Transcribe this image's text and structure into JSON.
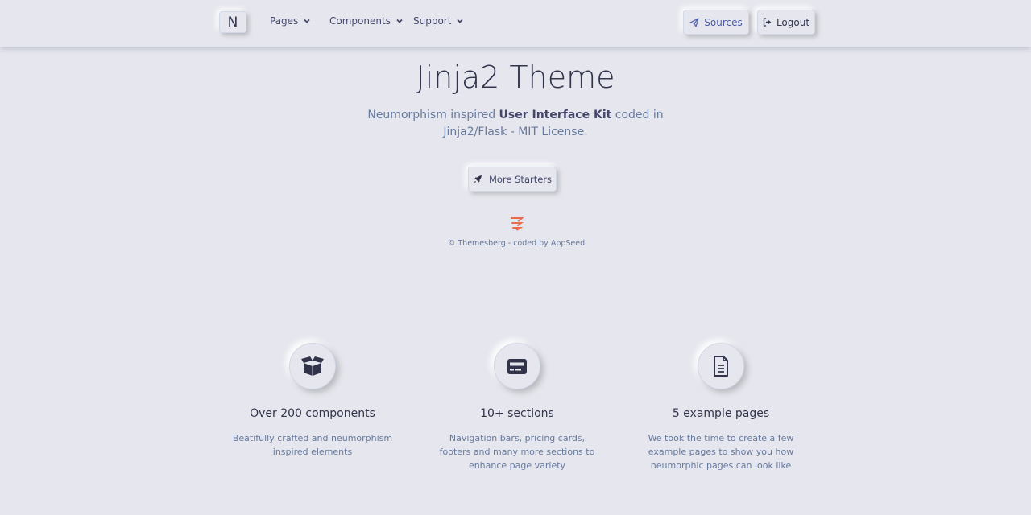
{
  "nav": {
    "brand": "N",
    "items": [
      {
        "label": "Pages"
      },
      {
        "label": "Components"
      },
      {
        "label": "Support"
      }
    ],
    "sources_label": "Sources",
    "logout_label": "Logout"
  },
  "hero": {
    "title": "Jinja2 Theme",
    "subtitle_pre": "Neumorphism inspired ",
    "subtitle_bold": "User Interface Kit",
    "subtitle_post": " coded in Jinja2/Flask - MIT License.",
    "button_label": "More Starters",
    "copyright": "© Themesberg - coded by AppSeed"
  },
  "features": [
    {
      "title": "Over 200 components",
      "desc": "Beatifully crafted and neumorphism inspired elements",
      "icon": "box-open-icon"
    },
    {
      "title": "10+ sections",
      "desc": "Navigation bars, pricing cards, footers and many more sections to enhance page variety",
      "icon": "credit-card-icon"
    },
    {
      "title": "5 example pages",
      "desc": "We took the time to create a few example pages to show you how neumorphic pages can look like",
      "icon": "file-icon"
    }
  ],
  "colors": {
    "background": "#e6e7ee",
    "text_dark": "#31344b",
    "text": "#44476a",
    "muted": "#66799e",
    "accent": "#4b59a5",
    "logo": "#e86b4a"
  }
}
